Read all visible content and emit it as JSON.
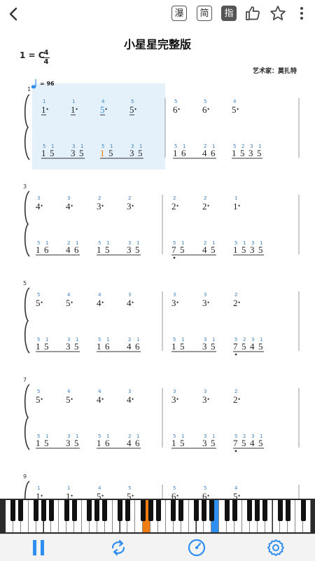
{
  "toolbar": {
    "btn_waterfall": "瀑",
    "btn_simple": "简",
    "btn_finger": "指"
  },
  "score": {
    "title": "小星星完整版",
    "key": "1 = C",
    "time_top": "4",
    "time_bottom": "4",
    "artist": "艺术家：莫扎特",
    "tempo": "= 96",
    "measure_numbers": [
      "1",
      "3",
      "5",
      "7",
      "9"
    ]
  },
  "colors": {
    "highlight": "#e4f1fb",
    "finger": "#3b82c4",
    "accent_orange": "#f07c12",
    "accent_blue": "#2f8ff0",
    "icons": "#2f8ff0"
  },
  "piano": {
    "pressed": [
      "orange",
      "blue"
    ]
  },
  "controls": [
    "pause-icon",
    "repeat-icon",
    "speed-icon",
    "settings-icon"
  ]
}
